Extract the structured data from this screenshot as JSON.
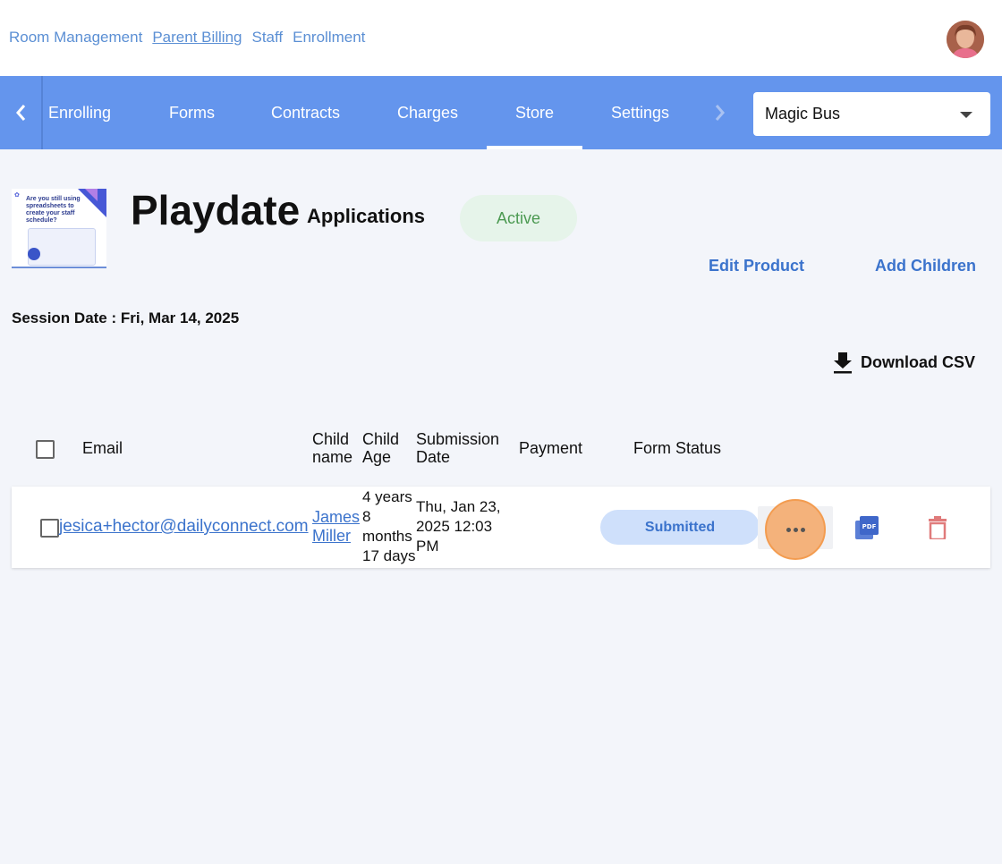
{
  "top_nav": {
    "items": [
      {
        "label": "Room Management"
      },
      {
        "label": "Parent Billing"
      },
      {
        "label": "Staff"
      },
      {
        "label": "Enrollment"
      }
    ]
  },
  "tabs": {
    "items": [
      "Enrolling",
      "Forms",
      "Contracts",
      "Charges",
      "Store",
      "Settings"
    ],
    "active": "Store"
  },
  "school_select": {
    "value": "Magic Bus"
  },
  "thumbnail": {
    "text": "Are you still using spreadsheets to create your staff schedule?"
  },
  "product": {
    "title": "Playdate",
    "subtitle": "Applications",
    "status": "Active",
    "edit_label": "Edit Product",
    "add_children_label": "Add Children",
    "session": "Session Date : Fri, Mar 14, 2025",
    "download_label": "Download CSV"
  },
  "table": {
    "headers": {
      "email": "Email",
      "child_name_1": "Child",
      "child_name_2": "name",
      "child_age_1": "Child",
      "child_age_2": "Age",
      "submission_1": "Submission",
      "submission_2": "Date",
      "payment": "Payment",
      "form_status": "Form Status"
    },
    "rows": [
      {
        "email": "jesica+hector@dailyconnect.com",
        "child_first": "James",
        "child_last": "Miller",
        "age_1": "4 years",
        "age_2": "8",
        "age_3": "months",
        "age_4": "17 days",
        "date_1": "Thu, Jan 23,",
        "date_2": "2025 12:03",
        "date_3": "PM",
        "payment": "",
        "form_status": "Submitted"
      }
    ]
  },
  "colors": {
    "tabbar": "#6495ed",
    "link": "#3b73cc",
    "active_pill": "#e6f4ea",
    "submitted_pill": "#cfe0fb",
    "highlight": "#f4b27b",
    "trash": "#d9534f"
  }
}
